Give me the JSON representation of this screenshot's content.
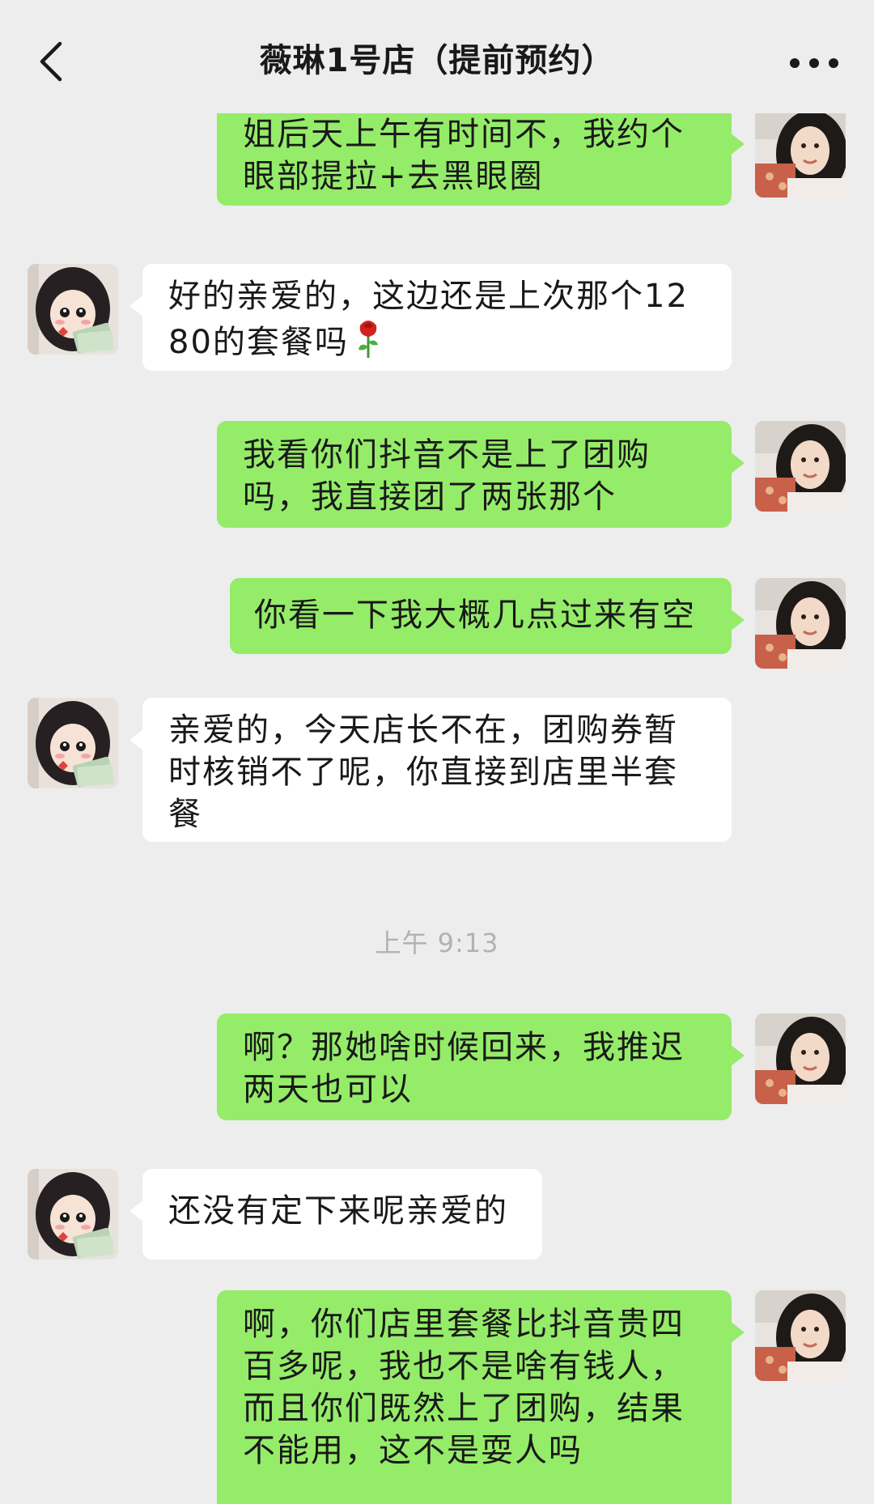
{
  "header": {
    "title": "薇琳1号店（提前预约）",
    "back_icon": "chevron-left-icon",
    "more_icon": "more-dots-icon"
  },
  "colors": {
    "self_bubble": "#95ec69",
    "other_bubble": "#ffffff",
    "background": "#ededed"
  },
  "messages": [
    {
      "from": "self",
      "text": "姐后天上午有时间不，我约个眼部提拉+去黑眼圈"
    },
    {
      "from": "other",
      "text": "好的亲爱的，这边还是上次那个1280的套餐吗",
      "emoji": "rose-icon"
    },
    {
      "from": "self",
      "text": "我看你们抖音不是上了团购吗，我直接团了两张那个"
    },
    {
      "from": "self",
      "text": "你看一下我大概几点过来有空"
    },
    {
      "from": "other",
      "text": "亲爱的，今天店长不在，团购券暂时核销不了呢，你直接到店里半套餐"
    },
    {
      "from": "self",
      "text": "啊？那她啥时候回来，我推迟两天也可以"
    },
    {
      "from": "other",
      "text": "还没有定下来呢亲爱的"
    },
    {
      "from": "self",
      "text": "啊，你们店里套餐比抖音贵四百多呢，我也不是啥有钱人，而且你们既然上了团购，结果不能用，这不是耍人吗"
    }
  ],
  "timestamp": "上午 9:13"
}
